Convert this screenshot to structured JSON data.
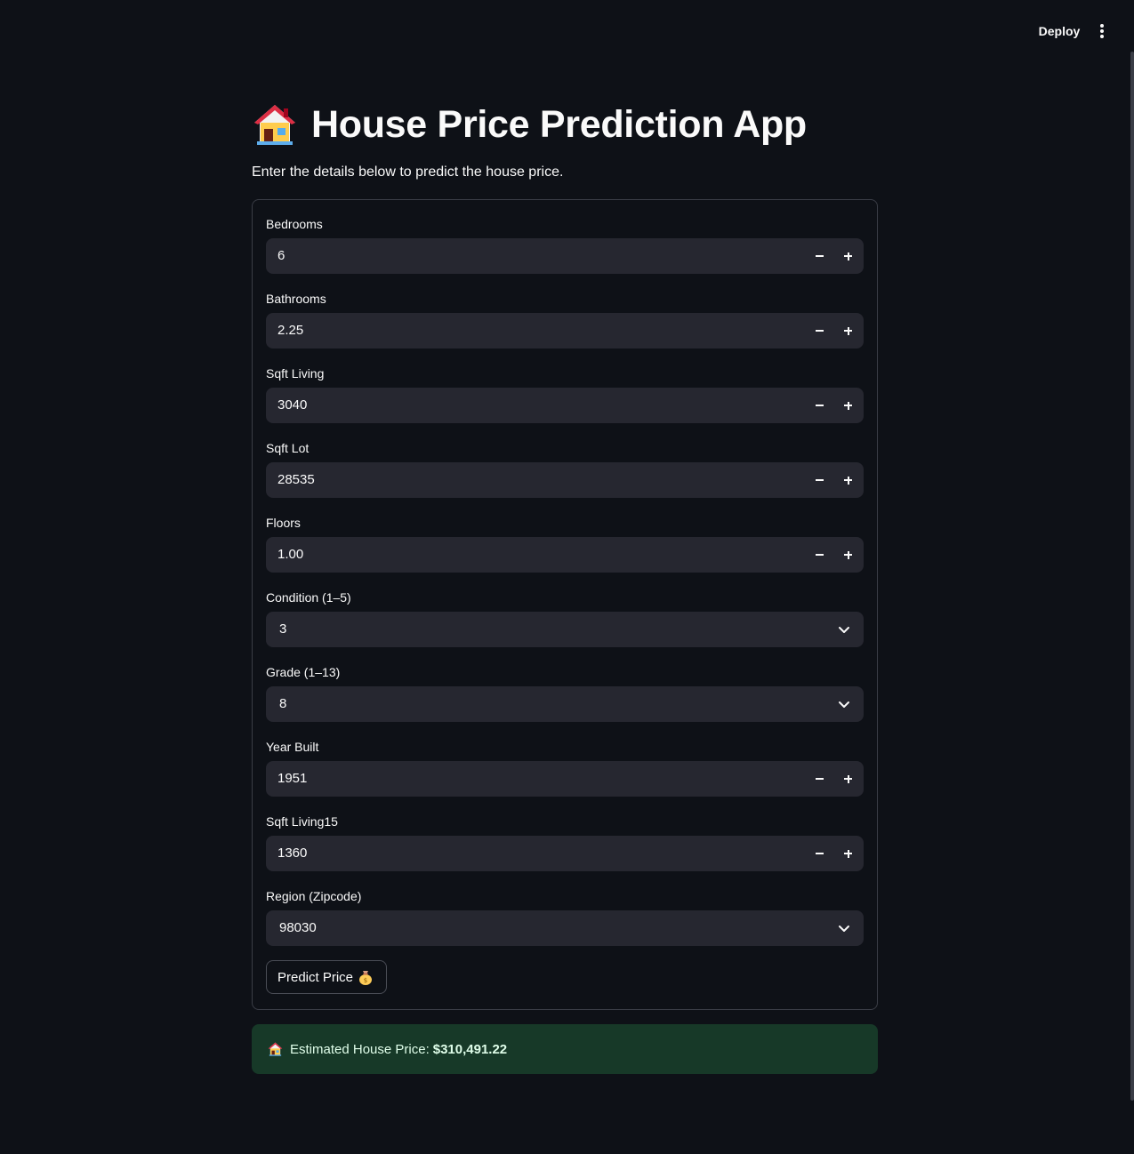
{
  "header": {
    "deploy_label": "Deploy",
    "menu_icon": "kebab-menu-icon"
  },
  "page": {
    "title": "House Price Prediction App",
    "title_icon": "house-icon",
    "subtitle": "Enter the details below to predict the house price."
  },
  "form": {
    "fields": [
      {
        "label": "Bedrooms",
        "value": "6",
        "type": "number"
      },
      {
        "label": "Bathrooms",
        "value": "2.25",
        "type": "number"
      },
      {
        "label": "Sqft Living",
        "value": "3040",
        "type": "number"
      },
      {
        "label": "Sqft Lot",
        "value": "28535",
        "type": "number"
      },
      {
        "label": "Floors",
        "value": "1.00",
        "type": "number"
      },
      {
        "label": "Condition (1–5)",
        "value": "3",
        "type": "select"
      },
      {
        "label": "Grade (1–13)",
        "value": "8",
        "type": "select"
      },
      {
        "label": "Year Built",
        "value": "1951",
        "type": "number"
      },
      {
        "label": "Sqft Living15",
        "value": "1360",
        "type": "number"
      },
      {
        "label": "Region (Zipcode)",
        "value": "98030",
        "type": "select"
      }
    ],
    "predict_label": "Predict Price",
    "predict_icon": "money-bag-icon"
  },
  "result": {
    "icon": "house-icon",
    "label": "Estimated House Price:",
    "value": "$310,491.22"
  },
  "colors": {
    "background": "#0e1117",
    "input_background": "#262730",
    "success_background": "#173928",
    "success_text": "#dffde9",
    "text": "#fafafa"
  }
}
